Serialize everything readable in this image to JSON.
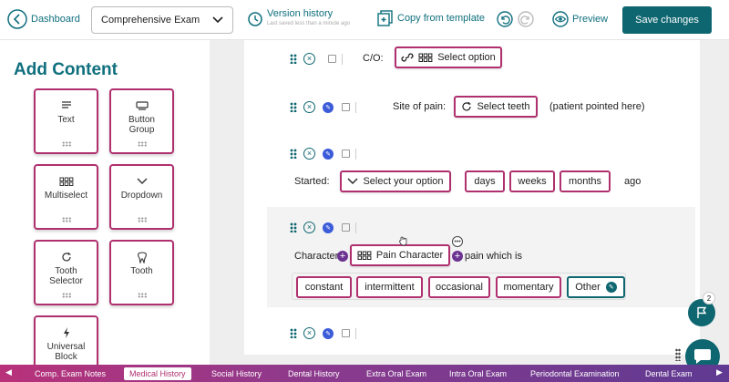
{
  "header": {
    "back_label": "Dashboard",
    "exam_select_value": "Comprehensive Exam",
    "version_history_label": "Version history",
    "version_history_sub": "Last saved less than a minute ago",
    "copy_template_label": "Copy from template",
    "preview_label": "Preview",
    "save_label": "Save changes"
  },
  "sidebar": {
    "title": "Add Content",
    "tiles": [
      {
        "label": "Text",
        "icon": "text-lines-icon"
      },
      {
        "label": "Button Group",
        "icon": "button-group-icon"
      },
      {
        "label": "Multiselect",
        "icon": "grid-icon"
      },
      {
        "label": "Dropdown",
        "icon": "chevron-down-icon"
      },
      {
        "label": "Tooth Selector",
        "icon": "refresh-icon"
      },
      {
        "label": "Tooth",
        "icon": "tooth-icon"
      },
      {
        "label": "Universal Block",
        "icon": "lightning-icon"
      }
    ]
  },
  "rows": {
    "co": {
      "label": "C/O:",
      "button": "Select option"
    },
    "site": {
      "label": "Site of pain:",
      "button": "Select teeth",
      "note": "(patient pointed here)"
    },
    "started": {
      "label": "Started:",
      "dropdown": "Select your option",
      "units": [
        "days",
        "weeks",
        "months"
      ],
      "suffix": "ago"
    },
    "character": {
      "label": "Character:",
      "button": "Pain Character",
      "suffix": "pain which is",
      "options": [
        "constant",
        "intermittent",
        "occasional",
        "momentary",
        "Other"
      ]
    }
  },
  "flag_badge": "2",
  "tabs": [
    "Comp. Exam Notes",
    "Medical History",
    "Social History",
    "Dental History",
    "Extra Oral Exam",
    "Intra Oral Exam",
    "Periodontal Examination",
    "Dental Exam"
  ],
  "active_tab": "Medical History",
  "colors": {
    "teal": "#0e6670",
    "magenta": "#b0306f",
    "purple": "#6a3291"
  }
}
